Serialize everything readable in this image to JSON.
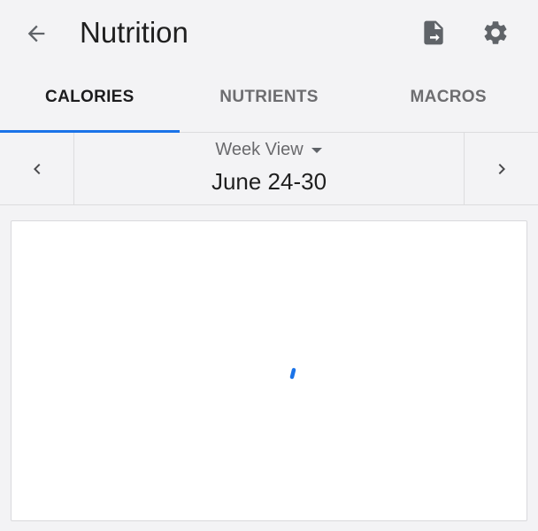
{
  "header": {
    "title": "Nutrition",
    "back_icon": "arrow-left-icon",
    "export_icon": "file-export-icon",
    "settings_icon": "gear-icon"
  },
  "tabs": [
    {
      "label": "CALORIES",
      "active": true
    },
    {
      "label": "NUTRIENTS",
      "active": false
    },
    {
      "label": "MACROS",
      "active": false
    }
  ],
  "week_nav": {
    "view_label": "Week View",
    "date_range": "June 24-30",
    "prev_icon": "chevron-left-icon",
    "next_icon": "chevron-right-icon",
    "dropdown_icon": "caret-down-icon"
  },
  "content": {
    "loading_icon": "loading-spinner-icon"
  },
  "colors": {
    "accent": "#1a73e8",
    "background": "#f3f3f5",
    "card": "#ffffff"
  }
}
